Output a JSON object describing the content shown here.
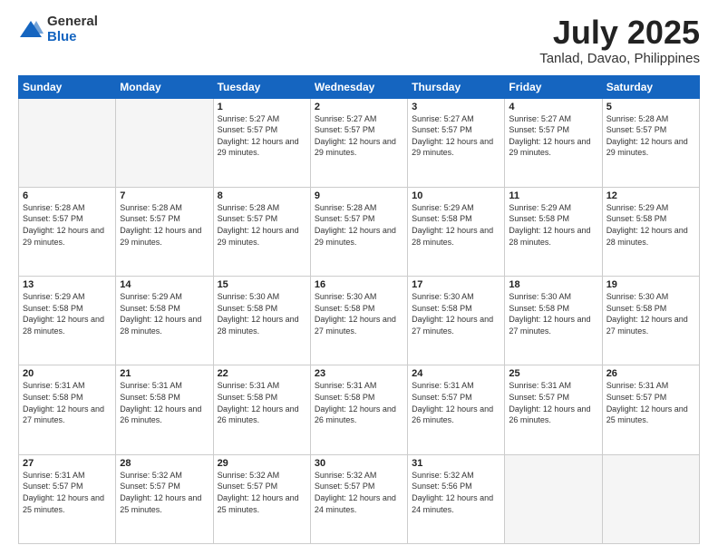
{
  "header": {
    "logo_general": "General",
    "logo_blue": "Blue",
    "title": "July 2025",
    "location": "Tanlad, Davao, Philippines"
  },
  "days_of_week": [
    "Sunday",
    "Monday",
    "Tuesday",
    "Wednesday",
    "Thursday",
    "Friday",
    "Saturday"
  ],
  "weeks": [
    [
      {
        "day": "",
        "info": ""
      },
      {
        "day": "",
        "info": ""
      },
      {
        "day": "1",
        "info": "Sunrise: 5:27 AM\nSunset: 5:57 PM\nDaylight: 12 hours and 29 minutes."
      },
      {
        "day": "2",
        "info": "Sunrise: 5:27 AM\nSunset: 5:57 PM\nDaylight: 12 hours and 29 minutes."
      },
      {
        "day": "3",
        "info": "Sunrise: 5:27 AM\nSunset: 5:57 PM\nDaylight: 12 hours and 29 minutes."
      },
      {
        "day": "4",
        "info": "Sunrise: 5:27 AM\nSunset: 5:57 PM\nDaylight: 12 hours and 29 minutes."
      },
      {
        "day": "5",
        "info": "Sunrise: 5:28 AM\nSunset: 5:57 PM\nDaylight: 12 hours and 29 minutes."
      }
    ],
    [
      {
        "day": "6",
        "info": "Sunrise: 5:28 AM\nSunset: 5:57 PM\nDaylight: 12 hours and 29 minutes."
      },
      {
        "day": "7",
        "info": "Sunrise: 5:28 AM\nSunset: 5:57 PM\nDaylight: 12 hours and 29 minutes."
      },
      {
        "day": "8",
        "info": "Sunrise: 5:28 AM\nSunset: 5:57 PM\nDaylight: 12 hours and 29 minutes."
      },
      {
        "day": "9",
        "info": "Sunrise: 5:28 AM\nSunset: 5:57 PM\nDaylight: 12 hours and 29 minutes."
      },
      {
        "day": "10",
        "info": "Sunrise: 5:29 AM\nSunset: 5:58 PM\nDaylight: 12 hours and 28 minutes."
      },
      {
        "day": "11",
        "info": "Sunrise: 5:29 AM\nSunset: 5:58 PM\nDaylight: 12 hours and 28 minutes."
      },
      {
        "day": "12",
        "info": "Sunrise: 5:29 AM\nSunset: 5:58 PM\nDaylight: 12 hours and 28 minutes."
      }
    ],
    [
      {
        "day": "13",
        "info": "Sunrise: 5:29 AM\nSunset: 5:58 PM\nDaylight: 12 hours and 28 minutes."
      },
      {
        "day": "14",
        "info": "Sunrise: 5:29 AM\nSunset: 5:58 PM\nDaylight: 12 hours and 28 minutes."
      },
      {
        "day": "15",
        "info": "Sunrise: 5:30 AM\nSunset: 5:58 PM\nDaylight: 12 hours and 28 minutes."
      },
      {
        "day": "16",
        "info": "Sunrise: 5:30 AM\nSunset: 5:58 PM\nDaylight: 12 hours and 27 minutes."
      },
      {
        "day": "17",
        "info": "Sunrise: 5:30 AM\nSunset: 5:58 PM\nDaylight: 12 hours and 27 minutes."
      },
      {
        "day": "18",
        "info": "Sunrise: 5:30 AM\nSunset: 5:58 PM\nDaylight: 12 hours and 27 minutes."
      },
      {
        "day": "19",
        "info": "Sunrise: 5:30 AM\nSunset: 5:58 PM\nDaylight: 12 hours and 27 minutes."
      }
    ],
    [
      {
        "day": "20",
        "info": "Sunrise: 5:31 AM\nSunset: 5:58 PM\nDaylight: 12 hours and 27 minutes."
      },
      {
        "day": "21",
        "info": "Sunrise: 5:31 AM\nSunset: 5:58 PM\nDaylight: 12 hours and 26 minutes."
      },
      {
        "day": "22",
        "info": "Sunrise: 5:31 AM\nSunset: 5:58 PM\nDaylight: 12 hours and 26 minutes."
      },
      {
        "day": "23",
        "info": "Sunrise: 5:31 AM\nSunset: 5:58 PM\nDaylight: 12 hours and 26 minutes."
      },
      {
        "day": "24",
        "info": "Sunrise: 5:31 AM\nSunset: 5:57 PM\nDaylight: 12 hours and 26 minutes."
      },
      {
        "day": "25",
        "info": "Sunrise: 5:31 AM\nSunset: 5:57 PM\nDaylight: 12 hours and 26 minutes."
      },
      {
        "day": "26",
        "info": "Sunrise: 5:31 AM\nSunset: 5:57 PM\nDaylight: 12 hours and 25 minutes."
      }
    ],
    [
      {
        "day": "27",
        "info": "Sunrise: 5:31 AM\nSunset: 5:57 PM\nDaylight: 12 hours and 25 minutes."
      },
      {
        "day": "28",
        "info": "Sunrise: 5:32 AM\nSunset: 5:57 PM\nDaylight: 12 hours and 25 minutes."
      },
      {
        "day": "29",
        "info": "Sunrise: 5:32 AM\nSunset: 5:57 PM\nDaylight: 12 hours and 25 minutes."
      },
      {
        "day": "30",
        "info": "Sunrise: 5:32 AM\nSunset: 5:57 PM\nDaylight: 12 hours and 24 minutes."
      },
      {
        "day": "31",
        "info": "Sunrise: 5:32 AM\nSunset: 5:56 PM\nDaylight: 12 hours and 24 minutes."
      },
      {
        "day": "",
        "info": ""
      },
      {
        "day": "",
        "info": ""
      }
    ]
  ]
}
